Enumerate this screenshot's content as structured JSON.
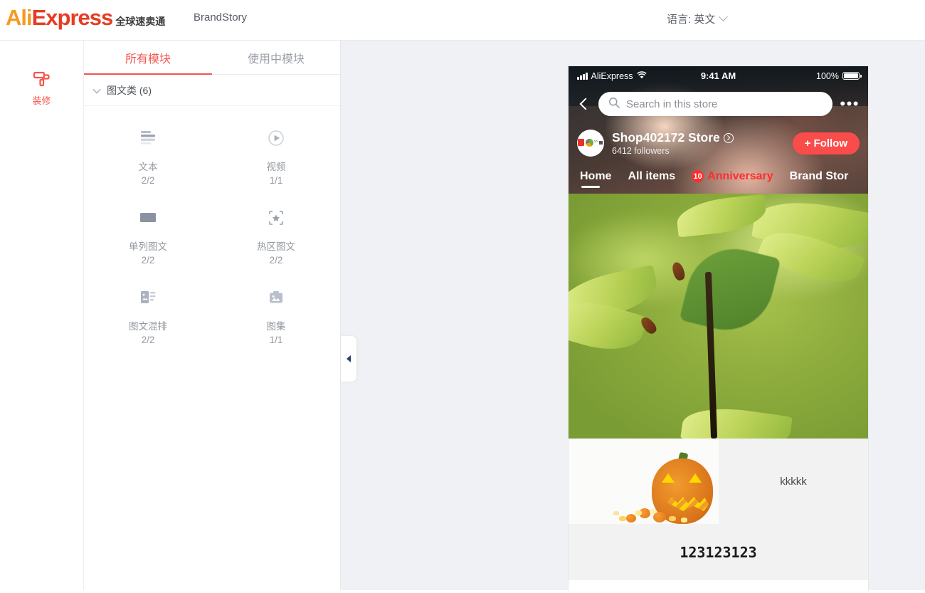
{
  "header": {
    "logo_ali": "Ali",
    "logo_express": "Express",
    "logo_cn": "全球速卖通",
    "brand_story": "BrandStory",
    "language_label": "语言: 英文",
    "chevron_icon": "chevron-down-icon"
  },
  "rail": {
    "items": [
      {
        "icon": "paint-roller-icon",
        "label": "装修"
      }
    ]
  },
  "panel": {
    "tabs": [
      {
        "label": "所有模块",
        "active": true
      },
      {
        "label": "使用中模块",
        "active": false
      }
    ],
    "section": {
      "title": "图文类 (6)",
      "caret_icon": "chevron-down-icon"
    },
    "modules": [
      {
        "icon": "text-lines-icon",
        "name": "文本",
        "count": "2/2"
      },
      {
        "icon": "video-play-icon",
        "name": "视频",
        "count": "1/1"
      },
      {
        "icon": "single-image-icon",
        "name": "单列图文",
        "count": "2/2"
      },
      {
        "icon": "hotspot-image-icon",
        "name": "热区图文",
        "count": "2/2"
      },
      {
        "icon": "image-text-mix-icon",
        "name": "图文混排",
        "count": "2/2"
      },
      {
        "icon": "gallery-icon",
        "name": "图集",
        "count": "1/1"
      }
    ]
  },
  "canvas": {
    "collapse_handle_icon": "triangle-left-icon"
  },
  "preview": {
    "statusbar": {
      "signal_icon": "signal-bars-icon",
      "carrier": "AliExpress",
      "wifi_icon": "wifi-icon",
      "time": "9:41 AM",
      "battery_percent": "100%",
      "battery_icon": "battery-full-icon"
    },
    "nav_bar": {
      "back_icon": "chevron-left-icon",
      "search_icon": "search-icon",
      "search_placeholder": "Search in this store",
      "more_icon": "more-dots-icon"
    },
    "shop": {
      "avatar_icon": "shop-avatar",
      "name": "Shop402172 Store",
      "name_arrow_icon": "arrow-right-circle-icon",
      "followers": "6412 followers",
      "follow_button": "+ Follow"
    },
    "store_tabs": [
      {
        "label": "Home",
        "active": true,
        "promo": false,
        "badge": ""
      },
      {
        "label": "All items",
        "active": false,
        "promo": false,
        "badge": ""
      },
      {
        "label": "Anniversary",
        "active": false,
        "promo": true,
        "badge": "10"
      },
      {
        "label": "Brand Stor",
        "active": false,
        "promo": false,
        "badge": ""
      }
    ],
    "hero_image_alt": "green-leaf-sprout-photo",
    "photo_text_block": {
      "image_alt": "halloween-pumpkin-photo",
      "text": "kkkkk"
    },
    "bold_text_block": "123123123"
  },
  "colors": {
    "brand_orange": "#f79a1f",
    "brand_red": "#e63c20",
    "accent_red": "#f4564e",
    "follow_red": "#fb4c4c",
    "canvas_bg": "#f0f1f5",
    "muted_text": "#9399a3"
  }
}
